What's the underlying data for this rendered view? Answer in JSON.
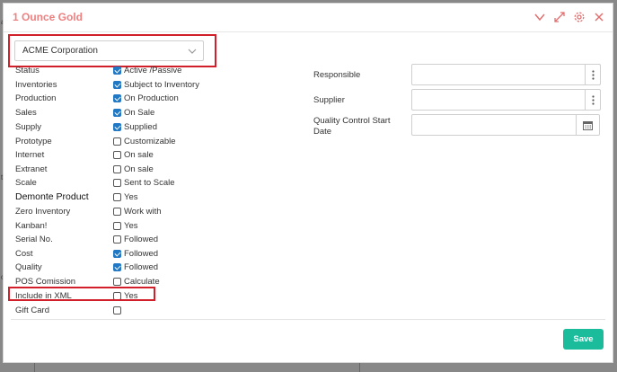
{
  "modal": {
    "title": "1 Ounce Gold",
    "company_select": {
      "value": "ACME Corporation"
    }
  },
  "colors": {
    "title": "#f08080",
    "accent": "#1abc9c",
    "checkbox": "#2178c4",
    "highlight": "#d2202a"
  },
  "icons": [
    "chevron-down-icon",
    "expand-icon",
    "gear-icon",
    "close-icon",
    "more-vertical-icon",
    "calendar-icon"
  ],
  "fields": [
    {
      "label": "Status",
      "checked": true,
      "value": "Active /Passive"
    },
    {
      "label": "Inventories",
      "checked": true,
      "value": "Subject to Inventory"
    },
    {
      "label": "Production",
      "checked": true,
      "value": "On Production"
    },
    {
      "label": "Sales",
      "checked": true,
      "value": "On Sale"
    },
    {
      "label": "Supply",
      "checked": true,
      "value": "Supplied"
    },
    {
      "label": "Prototype",
      "checked": false,
      "value": "Customizable"
    },
    {
      "label": "Internet",
      "checked": false,
      "value": "On sale"
    },
    {
      "label": "Extranet",
      "checked": false,
      "value": "On sale"
    },
    {
      "label": "Scale",
      "checked": false,
      "value": "Sent to Scale"
    },
    {
      "label": "Demonte Product",
      "checked": false,
      "value": "Yes"
    },
    {
      "label": "Zero Inventory",
      "checked": false,
      "value": "Work with"
    },
    {
      "label": "Kanban!",
      "checked": false,
      "value": "Yes"
    },
    {
      "label": "Serial No.",
      "checked": false,
      "value": "Followed"
    },
    {
      "label": "Cost",
      "checked": true,
      "value": "Followed"
    },
    {
      "label": "Quality",
      "checked": true,
      "value": "Followed"
    },
    {
      "label": "POS Comission",
      "checked": false,
      "value": "Calculate"
    },
    {
      "label": "Include in XML",
      "checked": false,
      "value": "Yes"
    },
    {
      "label": "Gift Card",
      "checked": false,
      "value": ""
    }
  ],
  "right": {
    "responsible": {
      "label": "Responsible",
      "value": ""
    },
    "supplier": {
      "label": "Supplier",
      "value": ""
    },
    "qc_start_date": {
      "label": "Quality Control Start Date",
      "value": ""
    }
  },
  "footer": {
    "save_label": "Save"
  }
}
